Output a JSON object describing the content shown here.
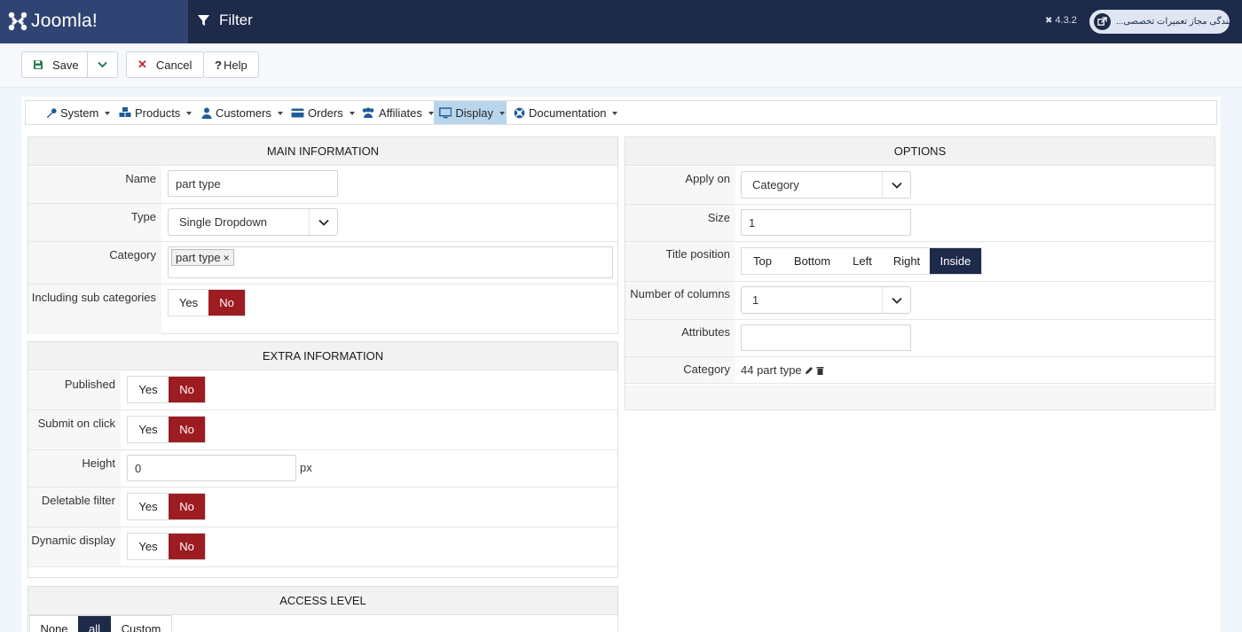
{
  "header": {
    "brand": "Joomla!",
    "title": "Filter",
    "version": "4.3.2",
    "site_name": "نمایندگی مجاز تعمیرات تخصصی..."
  },
  "toolbar": {
    "save": "Save",
    "cancel": "Cancel",
    "help": "Help"
  },
  "menu": {
    "items": [
      "System",
      "Products",
      "Customers",
      "Orders",
      "Affiliates",
      "Display",
      "Documentation"
    ],
    "active": "Display"
  },
  "main_info": {
    "heading": "MAIN INFORMATION",
    "name_label": "Name",
    "name_value": "part type",
    "type_label": "Type",
    "type_value": "Single Dropdown",
    "category_label": "Category",
    "category_tag": "part type",
    "subcat_label": "Including sub categories",
    "yes": "Yes",
    "no": "No"
  },
  "extra_info": {
    "heading": "EXTRA INFORMATION",
    "published_label": "Published",
    "submit_label": "Submit on click",
    "height_label": "Height",
    "height_value": "0",
    "height_unit": "px",
    "deletable_label": "Deletable filter",
    "dynamic_label": "Dynamic display",
    "yes": "Yes",
    "no": "No"
  },
  "access": {
    "heading": "ACCESS LEVEL",
    "options": [
      "None",
      "all",
      "Custom"
    ],
    "selected": "all"
  },
  "options": {
    "heading": "OPTIONS",
    "apply_label": "Apply on",
    "apply_value": "Category",
    "size_label": "Size",
    "size_value": "1",
    "title_pos_label": "Title position",
    "title_positions": [
      "Top",
      "Bottom",
      "Left",
      "Right",
      "Inside"
    ],
    "title_pos_selected": "Inside",
    "columns_label": "Number of columns",
    "columns_value": "1",
    "attributes_label": "Attributes",
    "attributes_value": "",
    "category_label": "Category",
    "category_value": "44 part type"
  },
  "colors": {
    "header_bg": "#1e2a4a",
    "logo_bg": "#2f4472",
    "no_active": "#9d1c21",
    "selected_navy": "#1e2a4a",
    "menu_active": "#b8d5ec"
  }
}
